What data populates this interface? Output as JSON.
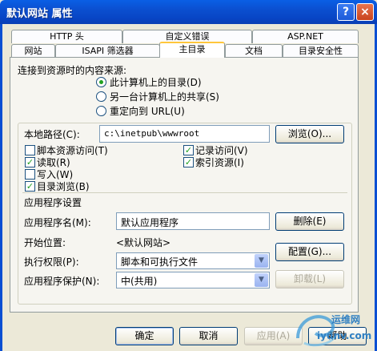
{
  "window": {
    "title": "默认网站 属性"
  },
  "titlebar_buttons": {
    "help": "?",
    "close": "×"
  },
  "tabs_row1": [
    {
      "label": "HTTP 头"
    },
    {
      "label": "自定义错误"
    },
    {
      "label": "ASP.NET"
    }
  ],
  "tabs_row2": [
    {
      "label": "网站"
    },
    {
      "label": "ISAPI 筛选器"
    },
    {
      "label": "主目录",
      "active": true
    },
    {
      "label": "文档"
    },
    {
      "label": "目录安全性"
    }
  ],
  "source": {
    "heading": "连接到资源时的内容来源:",
    "options": [
      {
        "label": "此计算机上的目录(D)",
        "selected": true
      },
      {
        "label": "另一台计算机上的共享(S)",
        "selected": false
      },
      {
        "label": "重定向到 URL(U)",
        "selected": false
      }
    ]
  },
  "local_path": {
    "label": "本地路径(C):",
    "value": "c:\\inetpub\\wwwroot",
    "browse_button": "浏览(O)..."
  },
  "permissions": [
    {
      "label": "脚本资源访问(T)",
      "checked": false
    },
    {
      "label": "记录访问(V)",
      "checked": true
    },
    {
      "label": "读取(R)",
      "checked": true
    },
    {
      "label": "索引资源(I)",
      "checked": true
    },
    {
      "label": "写入(W)",
      "checked": false
    },
    {
      "label": "目录浏览(B)",
      "checked": true
    }
  ],
  "app_settings": {
    "heading": "应用程序设置",
    "app_name_label": "应用程序名(M):",
    "app_name_value": "默认应用程序",
    "remove_button": "删除(E)",
    "start_point_label": "开始位置:",
    "start_point_value": "<默认网站>",
    "config_button": "配置(G)...",
    "exec_perm_label": "执行权限(P):",
    "exec_perm_value": "脚本和可执行文件",
    "protection_label": "应用程序保护(N):",
    "protection_value": "中(共用)",
    "unload_button": "卸载(L)"
  },
  "footer": {
    "ok": "确定",
    "cancel": "取消",
    "apply": "应用(A)",
    "help": "帮助"
  },
  "watermark": {
    "line1": "运维网",
    "line2": "iyunv.com"
  },
  "colors": {
    "titlebar": "#0b4fd0",
    "dialog_bg": "#ece9d8",
    "check_green": "#21a121",
    "active_tab_highlight": "#ffc73c"
  }
}
